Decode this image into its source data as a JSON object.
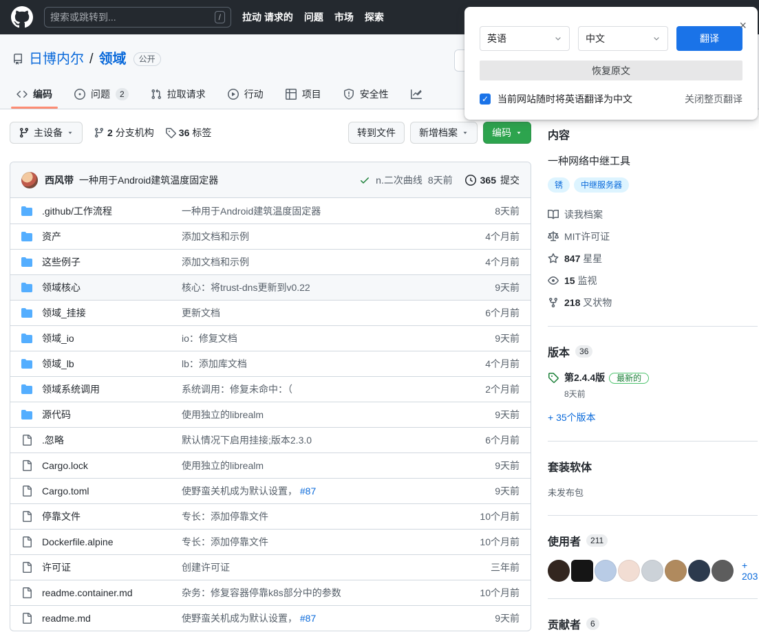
{
  "header": {
    "search_placeholder": "搜索或跳转到...",
    "search_shortcut": "/",
    "logo_icon": "github-logo-icon",
    "nav": [
      {
        "label": "拉动 请求的"
      },
      {
        "label": "问题"
      },
      {
        "label": "市场"
      },
      {
        "label": "探索"
      }
    ]
  },
  "translate_popup": {
    "close_icon": "×",
    "source_lang": "英语",
    "target_lang": "中文",
    "translate_button": "翻译",
    "restore_button": "恢复原文",
    "checkbox_checked": true,
    "checkbox_label": "当前网站随时将英语翻译为中文",
    "close_page_translate": "关闭整页翻译",
    "accent_color": "#1a73e8"
  },
  "repo": {
    "icon": "repo-icon",
    "owner": "日博内尔",
    "separator": "/",
    "name": "领域",
    "visibility": "公开"
  },
  "tabs": [
    {
      "icon": "code-icon",
      "label": "编码",
      "active": true
    },
    {
      "icon": "issue-icon",
      "label": "问题",
      "count": "2"
    },
    {
      "icon": "pr-icon",
      "label": "拉取请求"
    },
    {
      "icon": "actions-icon",
      "label": "行动"
    },
    {
      "icon": "projects-icon",
      "label": "项目"
    },
    {
      "icon": "security-icon",
      "label": "安全性"
    },
    {
      "icon": "insights-icon",
      "label": ""
    }
  ],
  "toolbar": {
    "branch_button": {
      "icon": "git-branch-icon",
      "label": "主设备",
      "caret": "caret-icon"
    },
    "branches": {
      "icon": "git-branch-icon",
      "count": "2",
      "label": "分支机构"
    },
    "tags": {
      "icon": "tag-icon",
      "count": "36",
      "label": "标签"
    },
    "go_to_file": "转到文件",
    "add_file": "新增档案",
    "code_button": "编码",
    "code_button_color": "#2da44e"
  },
  "commit_bar": {
    "author": "西风带",
    "message": "一种用于Android建筑温度固定器",
    "check_icon": "check-icon",
    "ref": "n.二次曲线",
    "time": "8天前",
    "history_icon": "history-icon",
    "commits_count": "365",
    "commits_label": "提交"
  },
  "files": [
    {
      "icon": "folder-icon",
      "type": "dir",
      "name": ".github/工作流程",
      "message": "一种用于Android建筑温度固定器",
      "time": "8天前"
    },
    {
      "icon": "folder-icon",
      "type": "dir",
      "name": "资产",
      "message": "添加文档和示例",
      "time": "4个月前"
    },
    {
      "icon": "folder-icon",
      "type": "dir",
      "name": "这些例子",
      "message": "添加文档和示例",
      "time": "4个月前"
    },
    {
      "icon": "folder-icon",
      "type": "dir",
      "name": "领域核心",
      "message": "核心：将trust-dns更新到v0.22",
      "time": "9天前",
      "hover": true
    },
    {
      "icon": "folder-icon",
      "type": "dir",
      "name": "领域_挂接",
      "message": "更新文档",
      "time": "6个月前"
    },
    {
      "icon": "folder-icon",
      "type": "dir",
      "name": "领域_io",
      "message": "io：修复文档",
      "time": "9天前"
    },
    {
      "icon": "folder-icon",
      "type": "dir",
      "name": "领域_lb",
      "message": "lb：添加库文档",
      "time": "4个月前"
    },
    {
      "icon": "folder-icon",
      "type": "dir",
      "name": "领域系统调用",
      "message": "系统调用：修复未命中：（",
      "time": "2个月前"
    },
    {
      "icon": "folder-icon",
      "type": "dir",
      "name": "源代码",
      "message": "使用独立的librealm",
      "time": "9天前"
    },
    {
      "icon": "file-icon",
      "type": "file",
      "name": ".忽略",
      "message": "默认情况下启用挂接;版本2.3.0",
      "time": "6个月前"
    },
    {
      "icon": "file-icon",
      "type": "file",
      "name": "Cargo.lock",
      "message": "使用独立的librealm",
      "time": "9天前"
    },
    {
      "icon": "file-icon",
      "type": "file",
      "name": "Cargo.toml",
      "message": "使野蛮关机成为默认设置，",
      "link": "#87",
      "time": "9天前"
    },
    {
      "icon": "file-icon",
      "type": "file",
      "name": "停靠文件",
      "message": "专长：添加停靠文件",
      "time": "10个月前"
    },
    {
      "icon": "file-icon",
      "type": "file",
      "name": "Dockerfile.alpine",
      "message": "专长：添加停靠文件",
      "time": "10个月前"
    },
    {
      "icon": "file-icon",
      "type": "file",
      "name": "许可证",
      "message": "创建许可证",
      "time": "三年前"
    },
    {
      "icon": "file-icon",
      "type": "file",
      "name": "readme.container.md",
      "message": "杂务：修复容器停靠k8s部分中的参数",
      "time": "10个月前"
    },
    {
      "icon": "file-icon",
      "type": "file",
      "name": "readme.md",
      "message": "使野蛮关机成为默认设置，",
      "link": "#87",
      "time": "9天前"
    }
  ],
  "sidebar": {
    "about": {
      "title": "内容",
      "description": "一种网络中继工具",
      "topics": [
        "锈",
        "中继服务器"
      ],
      "topic_color": "#0969da",
      "meta": [
        {
          "icon": "book-icon",
          "label": "读我档案"
        },
        {
          "icon": "law-icon",
          "label": "MIT许可证"
        },
        {
          "icon": "star-icon",
          "count": "847",
          "label": "星星"
        },
        {
          "icon": "eye-icon",
          "count": "15",
          "label": "监视"
        },
        {
          "icon": "fork-icon",
          "count": "218",
          "label": "叉状物"
        }
      ]
    },
    "releases": {
      "title": "版本",
      "count": "36",
      "tag_icon": "tag-icon",
      "latest_name": "第2.4.4版",
      "latest_badge": "最新的",
      "latest_badge_color": "#1a7f37",
      "latest_time": "8天前",
      "more_link": "+ 35个版本"
    },
    "packages": {
      "title": "套装软体",
      "empty_text": "未发布包"
    },
    "used_by": {
      "title": "使用者",
      "count": "211",
      "avatars": [
        {
          "color": "#33261f",
          "shape": "circle"
        },
        {
          "color": "#151515",
          "shape": "square"
        },
        {
          "color": "#b9cce6",
          "shape": "circle"
        },
        {
          "color": "#f2ddd3",
          "shape": "circle"
        },
        {
          "color": "#ccd2d8",
          "shape": "circle"
        },
        {
          "color": "#b08a5e",
          "shape": "circle"
        },
        {
          "color": "#2c3a4d",
          "shape": "circle"
        },
        {
          "color": "#5d5d5d",
          "shape": "circle"
        }
      ],
      "more_link": "+ 203"
    },
    "contributors": {
      "title": "贡献者",
      "count": "6"
    }
  }
}
